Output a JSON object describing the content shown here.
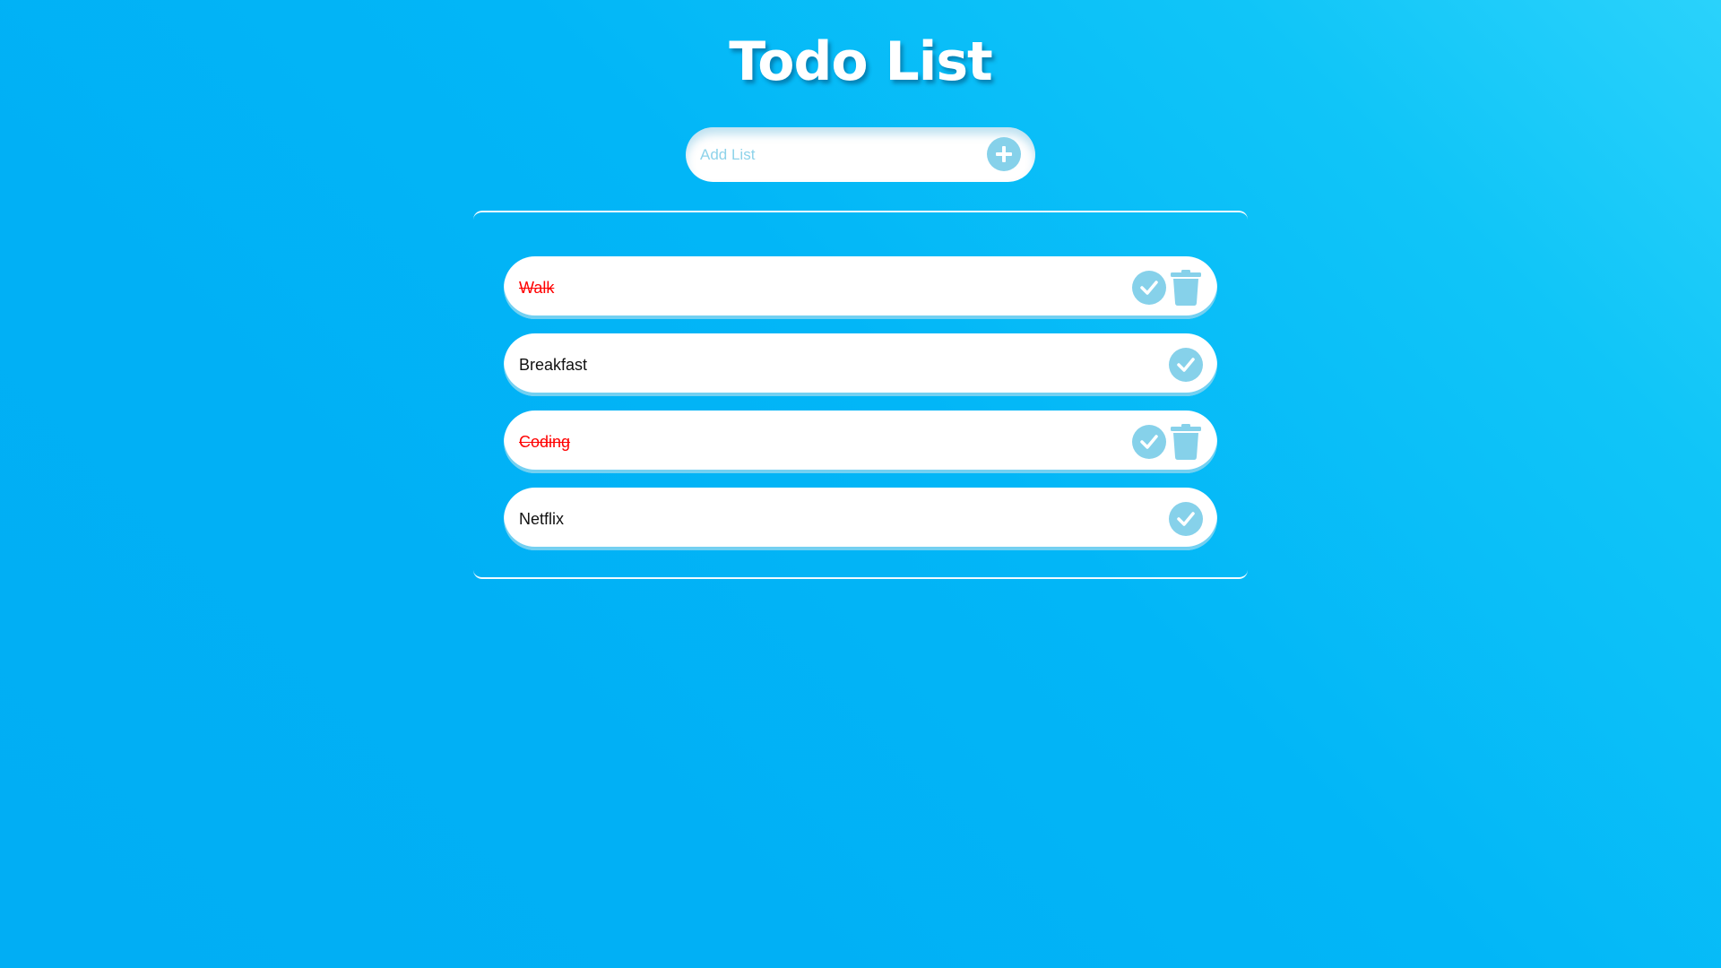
{
  "header": {
    "title": "Todo List"
  },
  "add_form": {
    "placeholder": "Add List",
    "value": "",
    "add_icon": "plus-icon"
  },
  "todos": [
    {
      "text": "Walk",
      "completed": true
    },
    {
      "text": "Breakfast",
      "completed": false
    },
    {
      "text": "Coding",
      "completed": true
    },
    {
      "text": "Netflix",
      "completed": false
    }
  ],
  "icons": {
    "complete": "check-icon",
    "delete": "trash-icon"
  },
  "colors": {
    "background_start": "#2ad2fb",
    "background_end": "#01aef4",
    "accent": "#86d1ea",
    "completed_text": "#ff0000",
    "text": "#111111",
    "surface": "#ffffff"
  }
}
